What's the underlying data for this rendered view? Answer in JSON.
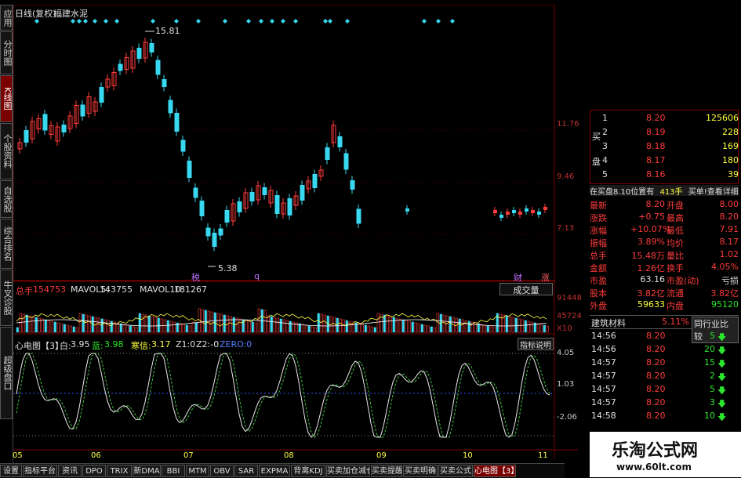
{
  "main": {
    "chart_title": "日线(复权)",
    "stock_name": "福建水泥",
    "price_labels": {
      "high": "15.81",
      "low": "5.38"
    },
    "y_ticks": [
      "11.76",
      "9.46",
      "7.13"
    ],
    "markers": {
      "bottom_a": "税",
      "bottom_b": "q",
      "bottom_c": "财",
      "bottom_d": "涨"
    }
  },
  "volume": {
    "title": "总手",
    "total": "154753",
    "mavol5_label": "MAVOL5:",
    "mavol5": "143755",
    "mavol10_label": "MAVOL10:",
    "mavol10": "181267",
    "button": "成交量",
    "y_ticks": [
      "91448",
      "45724",
      "X10"
    ]
  },
  "indicator": {
    "title": "心电图【3】",
    "white_label": "白:",
    "white_val": "3.95",
    "blue_label": "蓝:",
    "blue_val": "3.98",
    "avg_label": "寒信:",
    "avg_val": "3.17",
    "z1": "Z1:0",
    "z2": "Z2:-0",
    "zero": "ZERO:0",
    "button": "指标说明",
    "y_ticks": [
      "4.05",
      "1.03",
      "-2.06"
    ]
  },
  "x_axis": [
    "05",
    "06",
    "07",
    "08",
    "09",
    "10",
    "11"
  ],
  "left_nav": [
    {
      "label": "应用",
      "active": false
    },
    {
      "label": "分时图",
      "active": false
    },
    {
      "label": "K线图",
      "active": true
    },
    {
      "label": "个股资料",
      "active": false
    },
    {
      "label": "自选股",
      "active": false
    },
    {
      "label": "综合排名",
      "active": false
    },
    {
      "label": "牛叉诊股",
      "active": false
    },
    {
      "label": "超级盘口",
      "active": false
    }
  ],
  "order_book": {
    "side_labels": {
      "buy": "买",
      "plate": "盘"
    },
    "rows": [
      {
        "level": "1",
        "price": "8.20",
        "vol": "125606"
      },
      {
        "level": "2",
        "price": "8.19",
        "vol": "228"
      },
      {
        "level": "3",
        "price": "8.18",
        "vol": "169"
      },
      {
        "level": "4",
        "price": "8.17",
        "vol": "180"
      },
      {
        "level": "5",
        "price": "8.16",
        "vol": "39"
      }
    ],
    "notice": "在买盘8.10位置有",
    "notice_vol": "413手",
    "notice_action": "买单!查看详细"
  },
  "quote": {
    "rows": [
      {
        "l1": "最新",
        "v1": "8.20",
        "l2": "开盘",
        "v2": "8.00"
      },
      {
        "l1": "涨跌",
        "v1": "+0.75",
        "l2": "最高",
        "v2": "8.20"
      },
      {
        "l1": "涨幅",
        "v1": "+10.07%",
        "l2": "最低",
        "v2": "7.91"
      },
      {
        "l1": "振幅",
        "v1": "3.89%",
        "l2": "均价",
        "v2": "8.17"
      },
      {
        "l1": "总手",
        "v1": "15.48万",
        "l2": "量比",
        "v2": "1.02"
      },
      {
        "l1": "金额",
        "v1": "1.26亿",
        "l2": "换手",
        "v2": "4.05%"
      },
      {
        "l1": "市盈",
        "v1": "63.16",
        "l2": "市盈(动)",
        "v2": "亏损"
      },
      {
        "l1": "股本",
        "v1": "3.82亿",
        "l2": "流通",
        "v2": "3.82亿"
      },
      {
        "l1": "外盘",
        "v1": "59633",
        "l2": "内盘",
        "v2": "95120"
      }
    ]
  },
  "sector": {
    "name": "建筑材料",
    "pct": "5.11%",
    "button": "同行业比较"
  },
  "ticks": [
    {
      "time": "14:56",
      "price": "8.20",
      "vol": "5"
    },
    {
      "time": "14:56",
      "price": "8.20",
      "vol": "20"
    },
    {
      "time": "14:57",
      "price": "8.20",
      "vol": "15"
    },
    {
      "time": "14:57",
      "price": "8.20",
      "vol": "2"
    },
    {
      "time": "14:57",
      "price": "8.20",
      "vol": "5"
    },
    {
      "time": "14:57",
      "price": "8.20",
      "vol": "3"
    },
    {
      "time": "14:58",
      "price": "8.20",
      "vol": "10"
    }
  ],
  "bottom_tabs": [
    {
      "label": "设置",
      "active": false
    },
    {
      "label": "指标平台",
      "active": false
    },
    {
      "label": "资讯",
      "active": false
    },
    {
      "label": "DPO",
      "active": false
    },
    {
      "label": "TRIX",
      "active": false
    },
    {
      "label": "新DMA",
      "active": false
    },
    {
      "label": "BBI",
      "active": false
    },
    {
      "label": "MTM",
      "active": false
    },
    {
      "label": "OBV",
      "active": false
    },
    {
      "label": "SAR",
      "active": false
    },
    {
      "label": "EXPMA",
      "active": false
    },
    {
      "label": "背离KDJ",
      "active": false
    },
    {
      "label": "买卖加仓减仓",
      "active": false
    },
    {
      "label": "买卖提醒",
      "active": false
    },
    {
      "label": "买卖明确",
      "active": false
    },
    {
      "label": "买卖公式",
      "active": false
    },
    {
      "label": "心电图【3】",
      "active": true
    }
  ],
  "brand": {
    "title": "乐淘公式网",
    "url": "www.60lt.com"
  },
  "colors": {
    "up": "#ff3c3c",
    "down": "#38d8f0",
    "nav_active": "#7a0000"
  }
}
